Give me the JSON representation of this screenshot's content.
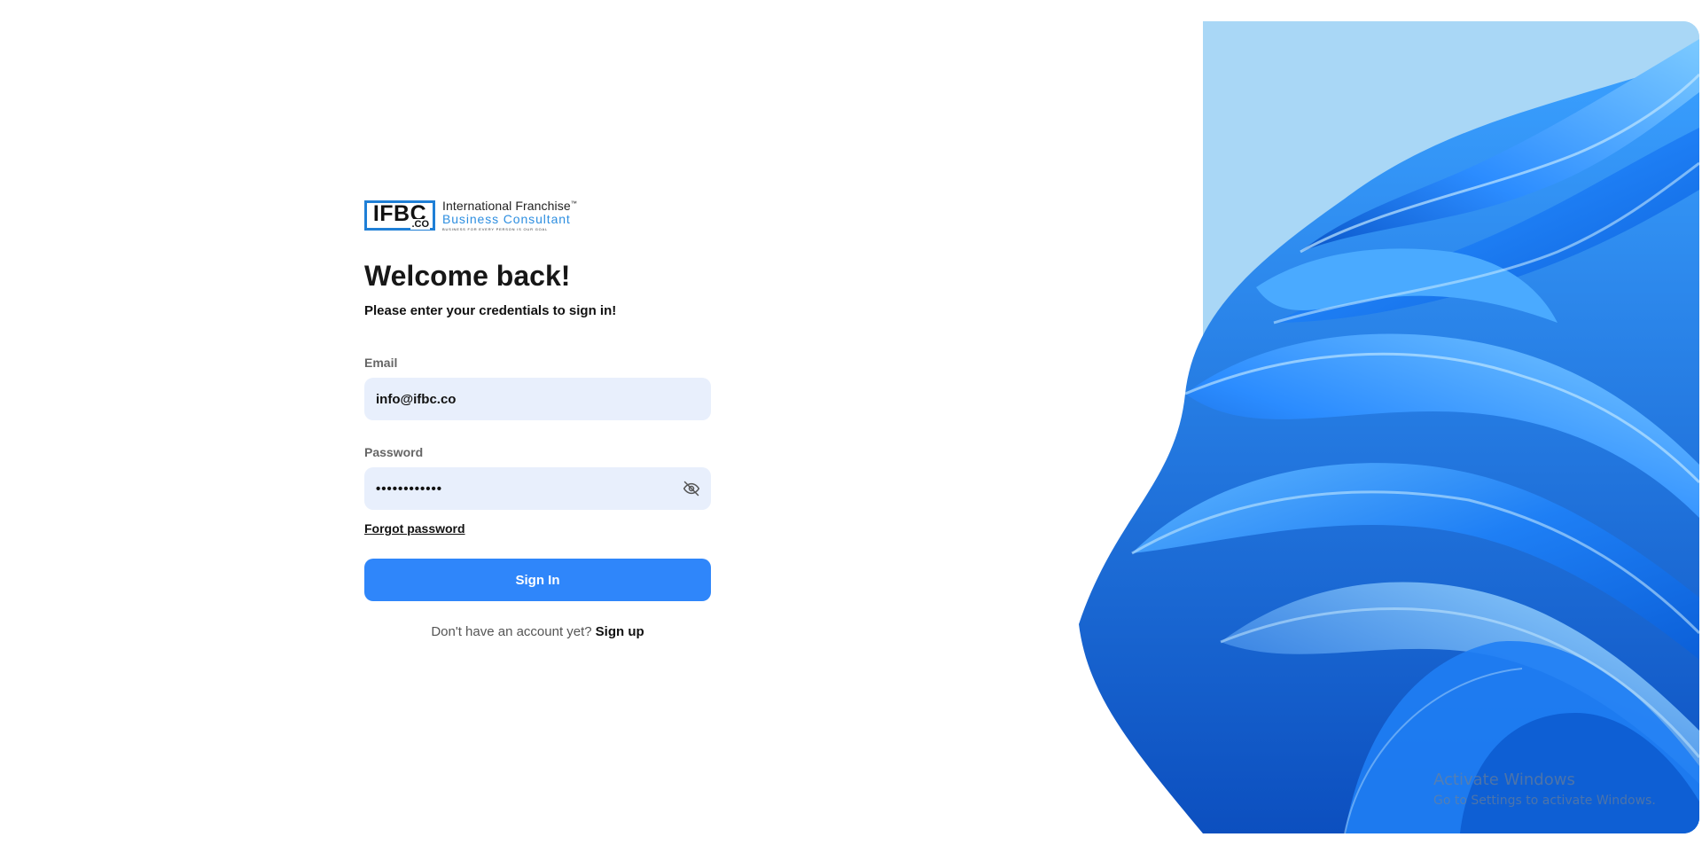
{
  "logo": {
    "mark": "IFBC",
    "tld": ".CO",
    "line1": "International Franchise",
    "line1_tm": "™",
    "line2": "Business Consultant",
    "line3": "Business for every person is our goal",
    "brand_blue": "#1f7fd6"
  },
  "heading": {
    "title": "Welcome back!",
    "subtitle": "Please enter your credentials to sign in!"
  },
  "form": {
    "email_label": "Email",
    "email_value": "info@ifbc.co",
    "password_label": "Password",
    "password_value": "••••••••••••",
    "password_toggle_icon": "eye-off-icon",
    "forgot_password": "Forgot password",
    "signin_button": "Sign In",
    "signup_prompt": "Don't have an account yet?",
    "signup_link": "Sign up"
  },
  "colors": {
    "primary_button": "#2f86fa",
    "input_background": "#e8effc",
    "hero_background": "#a5d5f6"
  },
  "watermark": {
    "line1": "Activate Windows",
    "line2": "Go to Settings to activate Windows."
  }
}
